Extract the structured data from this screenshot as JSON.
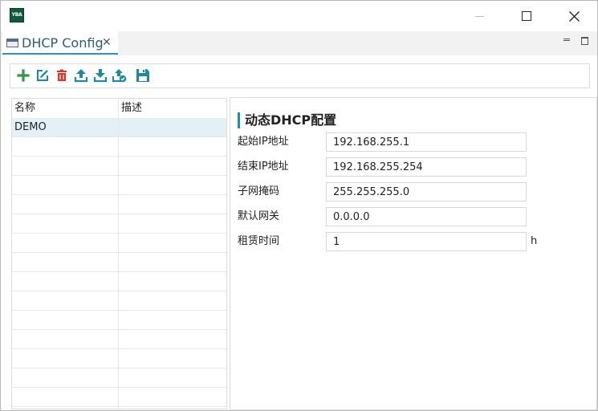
{
  "app": {
    "logo_text": "YBA",
    "brand_color": "#0f5b3a"
  },
  "window_controls": {
    "minimize": "minimize-icon",
    "maximize": "maximize-icon",
    "close": "close-icon"
  },
  "tab": {
    "label": "DHCP Config",
    "close_glyph": "✕",
    "accent_color": "#2b8fd0"
  },
  "toolbar": {
    "buttons": [
      {
        "name": "add",
        "icon": "plus-icon",
        "color": "#2e9a4a"
      },
      {
        "name": "edit",
        "icon": "edit-icon",
        "color": "#1a8aa6"
      },
      {
        "name": "delete",
        "icon": "trash-icon",
        "color": "#d9342b"
      },
      {
        "name": "upload",
        "icon": "upload-icon",
        "color": "#1a8aa6"
      },
      {
        "name": "download",
        "icon": "download-icon",
        "color": "#1a8aa6"
      },
      {
        "name": "apply",
        "icon": "deploy-icon",
        "color": "#1a8aa6"
      },
      {
        "name": "save",
        "icon": "save-icon",
        "color": "#1a8aa6"
      }
    ]
  },
  "list": {
    "columns": [
      "名称",
      "描述"
    ],
    "rows": [
      {
        "name": "DEMO",
        "desc": ""
      }
    ],
    "selected_row": 0
  },
  "form": {
    "title": "动态DHCP配置",
    "fields": [
      {
        "label": "起始IP地址",
        "value": "192.168.255.1"
      },
      {
        "label": "结束IP地址",
        "value": "192.168.255.254"
      },
      {
        "label": "子网掩码",
        "value": "255.255.255.0"
      },
      {
        "label": "默认网关",
        "value": "0.0.0.0"
      },
      {
        "label": "租赁时间",
        "value": "1",
        "unit": "h"
      }
    ]
  }
}
